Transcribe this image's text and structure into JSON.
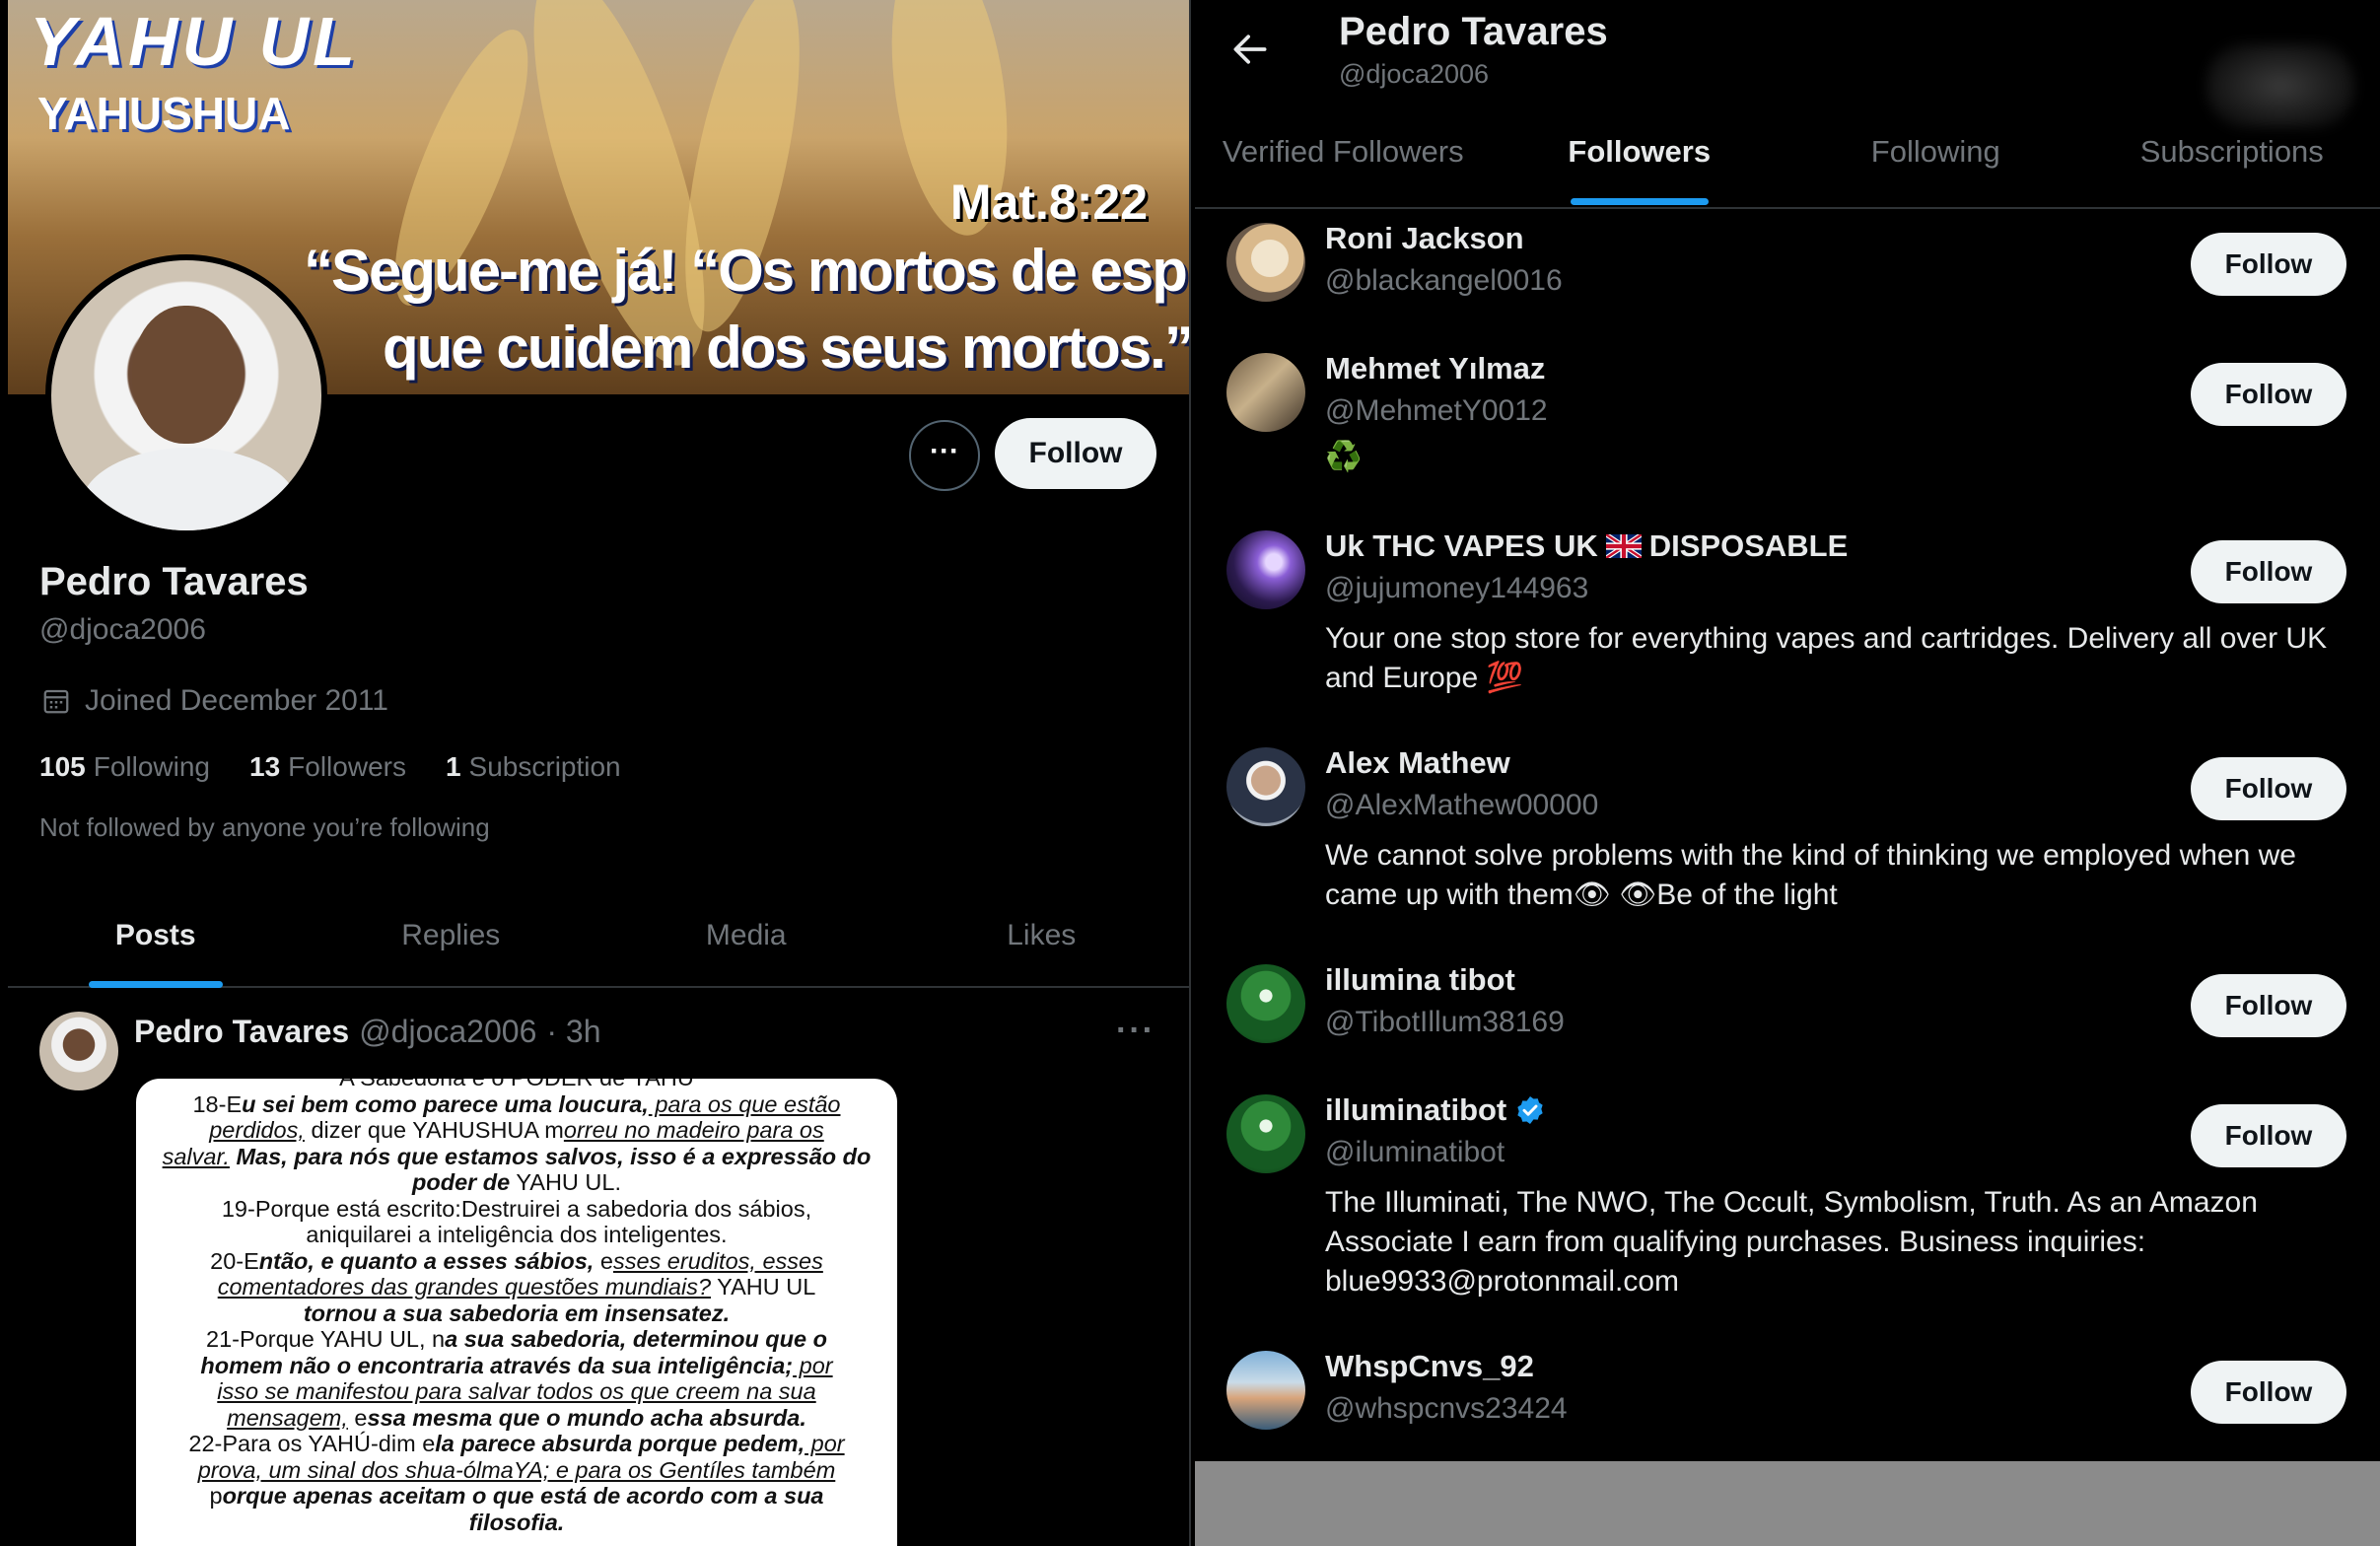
{
  "left": {
    "banner": {
      "line1": "YAHU  UL",
      "line2": "YAHUSHUA",
      "ref": "Mat.8:22",
      "quote1": "“Segue-me já! “Os mortos de espírito",
      "quote2": "que cuidem dos seus mortos.”"
    },
    "more_label": "···",
    "follow_label": "Follow",
    "name": "Pedro Tavares",
    "handle": "@djoca2006",
    "joined": "Joined December 2011",
    "stats": {
      "following_count": "105",
      "following_label": "Following",
      "followers_count": "13",
      "followers_label": "Followers",
      "subs_count": "1",
      "subs_label": "Subscription"
    },
    "not_followed": "Not followed by anyone you’re following",
    "tabs": [
      "Posts",
      "Replies",
      "Media",
      "Likes"
    ],
    "post": {
      "name": "Pedro Tavares",
      "handle": "@djoca2006",
      "time": "· 3h",
      "dots": "···",
      "image_text": {
        "l0": "A Sabedoria e o PODER de YAHU",
        "l1a": "18-E",
        "l1b": "u sei bem como parece uma loucura,",
        "l1c": " para os que estão",
        "l2a": "perdidos,",
        "l2b": " dizer que YAHUSHUA m",
        "l2c": "orreu no madeiro para os",
        "l3a": "salvar.",
        "l3b": " Mas, para nós que estamos salvos, isso é a expressão do",
        "l4a": "poder de",
        "l4b": " YAHU UL.",
        "l5": "19-Porque está escrito:Destruirei a sabedoria dos sábios,",
        "l6": "aniquilarei a inteligência dos inteligentes.",
        "l7a": "20-E",
        "l7b": "ntão, e quanto a esses sábios,",
        "l7c": " e",
        "l7d": "sses eruditos, esses",
        "l8a": "comentadores das grandes questões mundiais?",
        "l8b": " YAHU UL",
        "l9": "tornou a sua sabedoria em insensatez.",
        "l10a": "21-Porque YAHU UL, n",
        "l10b": "a sua sabedoria, determinou que o",
        "l11a": "homem não o encontraria através da sua inteligência;",
        "l11b": " por",
        "l12": "isso se manifestou para salvar todos os que creem na sua",
        "l13a": "mensagem,",
        "l13b": " e",
        "l13c": "ssa mesma que o mundo acha absurda.",
        "l14a": "22-Para os YAHÚ-dim e",
        "l14b": "la parece absurda porque pedem,",
        "l14c": " por",
        "l15": "prova, um sinal dos shua-ólmaYA; e para os Gentíles também",
        "l16a": "p",
        "l16b": "orque apenas aceitam o que está de acordo com a sua",
        "l17": "filosofia."
      }
    }
  },
  "right": {
    "name": "Pedro Tavares",
    "handle": "@djoca2006",
    "tabs": [
      "Verified Followers",
      "Followers",
      "Following",
      "Subscriptions"
    ],
    "follow_label": "Follow",
    "followers": [
      {
        "name": "Roni Jackson",
        "handle": "@blackangel0016",
        "bio": ""
      },
      {
        "name": "Mehmet Yılmaz",
        "handle": "@MehmetY0012",
        "bio": "♻️"
      },
      {
        "name_a": "Uk THC VAPES UK ",
        "name_b": "DISPOSABLE",
        "handle": "@jujumoney144963",
        "bio": "Your one stop store for everything vapes and cartridges. Delivery all over UK and Europe 💯"
      },
      {
        "name": "Alex Mathew",
        "handle": "@AlexMathew00000",
        "bio": "We cannot solve problems with the kind of thinking we employed when we came up with them👁 👁Be of the light"
      },
      {
        "name": "illumina tibot",
        "handle": "@TibotIllum38169",
        "bio": ""
      },
      {
        "name": "illuminatibot",
        "handle": "@iluminatibot",
        "bio": "The Illuminati, The NWO, The Occult, Symbolism, Truth. As an Amazon Associate I earn from qualifying purchases. Business inquiries: blue9933@protonmail.com"
      },
      {
        "name": "WhspCnvs_92",
        "handle": "@whspcnvs23424",
        "bio": ""
      }
    ],
    "colors": {
      "accent": "#1d9bf0",
      "muted": "#71767b",
      "text": "#e7e9ea",
      "button_bg": "#eff3f4"
    }
  }
}
